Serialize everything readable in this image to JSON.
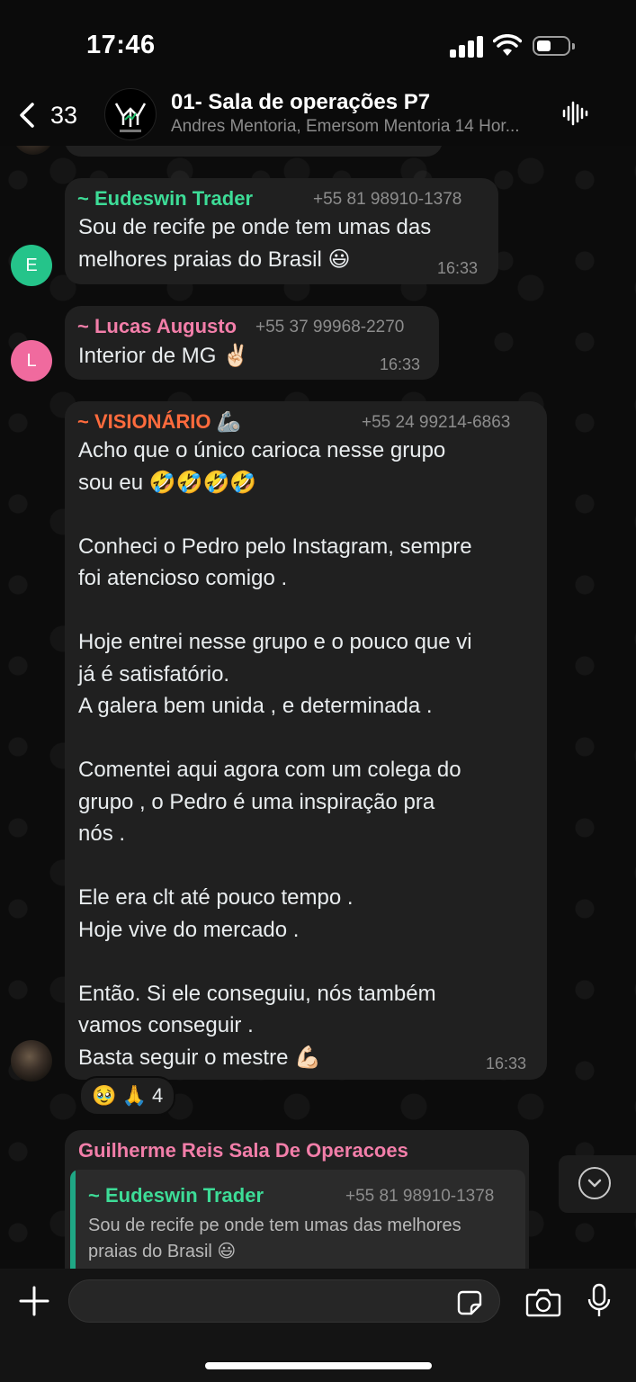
{
  "status": {
    "time": "17:46"
  },
  "header": {
    "back_count": "33",
    "title": "01- Sala de operações P7",
    "members": "Andres Mentoria, Emersom Mentoria 14 Hor..."
  },
  "colors": {
    "eudeswin": "#3ddc97",
    "lucas": "#f27ea9",
    "visionario": "#ff6b3d",
    "guilherme": "#f27ea9",
    "bubble": "#202020",
    "avatar_e": "#25c48a",
    "avatar_l": "#f06a9e"
  },
  "messages": [
    {
      "sender": "~ Eudeswin Trader",
      "phone": "+55 81 98910-1378",
      "text": "Sou de recife pe onde tem umas das\nmelhores praias do Brasil 😃",
      "time": "16:33",
      "avatar_letter": "E"
    },
    {
      "sender": "~ Lucas Augusto",
      "phone": "+55 37 99968-2270",
      "text": "Interior de MG ✌🏻",
      "time": "16:33",
      "avatar_letter": "L"
    },
    {
      "sender": "~ VISIONÁRIO 🦾",
      "phone": "+55 24 99214-6863",
      "text": "Acho que o único carioca nesse grupo\nsou eu 🤣🤣🤣🤣\n\nConheci o Pedro pelo Instagram, sempre\nfoi atencioso comigo .\n\nHoje entrei nesse grupo e o pouco que vi\njá é satisfatório.\nA galera bem unida , e determinada .\n\nComentei aqui agora com um colega do\ngrupo , o Pedro é uma inspiração pra\nnós .\n\nEle era clt até pouco tempo .\nHoje vive do mercado .\n\nEntão. Si ele conseguiu, nós também\nvamos conseguir .\nBasta seguir o mestre 💪🏻",
      "time": "16:33",
      "reactions": "🥹 🙏 4"
    },
    {
      "sender": "Guilherme Reis Sala De Operacoes",
      "quote_sender": "~ Eudeswin Trader",
      "quote_phone": "+55 81 98910-1378",
      "quote_text": "Sou de recife pe onde tem umas das melhores\npraias do Brasil 😃"
    }
  ],
  "composer": {
    "value": ""
  }
}
